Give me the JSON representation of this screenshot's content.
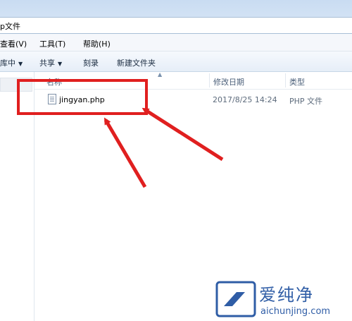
{
  "window": {
    "address_text": "p文件"
  },
  "menu": {
    "items": [
      "查看(V)",
      "工具(T)",
      "帮助(H)"
    ]
  },
  "toolbar": {
    "include_label": "库中",
    "share_label": "共享",
    "burn_label": "刻录",
    "new_folder_label": "新建文件夹"
  },
  "columns": {
    "name": "名称",
    "date": "修改日期",
    "type": "类型"
  },
  "files": [
    {
      "name": "jingyan.php",
      "date": "2017/8/25 14:24",
      "type": "PHP 文件"
    }
  ],
  "watermark": {
    "brand": "爱纯净",
    "url": "aichunjing.com"
  },
  "colors": {
    "annotation_red": "#e01f1f",
    "watermark_blue": "#2f5da6"
  }
}
